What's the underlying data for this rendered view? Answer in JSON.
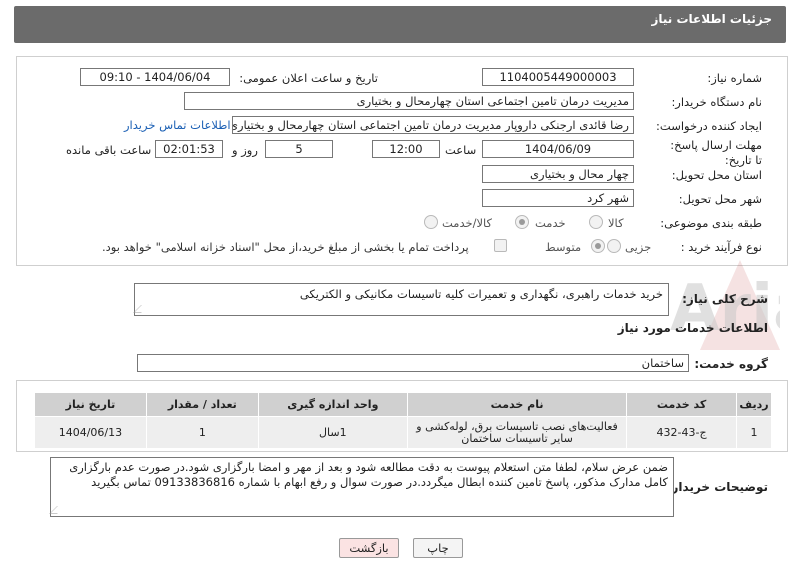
{
  "header": {
    "title": "جزئیات اطلاعات نیاز"
  },
  "need_number": {
    "label": "شماره نیاز:",
    "value": "1104005449000003"
  },
  "announce_datetime": {
    "label": "تاریخ و ساعت اعلان عمومی:",
    "value": "1404/06/04 - 09:10"
  },
  "buyer_org": {
    "label": "نام دستگاه خریدار:",
    "value": "مدیریت درمان تامین اجتماعی استان چهارمحال و بختیاری"
  },
  "requester": {
    "label": "ایجاد کننده درخواست:",
    "value": "رضا قائدی ارجنکی داروپار مدیریت درمان تامین اجتماعی استان چهارمحال و بختیاری",
    "contact_link": "اطلاعات تماس خریدار"
  },
  "deadline": {
    "label": "مهلت ارسال پاسخ: تا تاریخ:",
    "date": "1404/06/09",
    "time_label": "ساعت",
    "time": "12:00",
    "days": "5",
    "days_label": "روز و",
    "remaining": "02:01:53",
    "remaining_label": "ساعت باقی مانده"
  },
  "delivery_province": {
    "label": "استان محل تحویل:",
    "value": "چهار محال و بختیاری"
  },
  "delivery_city": {
    "label": "شهر محل تحویل:",
    "value": "شهر کرد"
  },
  "category": {
    "label": "طبقه بندی موضوعی:",
    "options": [
      "کالا",
      "خدمت",
      "کالا/خدمت"
    ],
    "selected": "خدمت"
  },
  "purchase_type": {
    "label": "نوع فرآیند خرید :",
    "options": [
      "جزیی",
      "متوسط"
    ],
    "selected": "متوسط",
    "treasury_note": "پرداخت تمام یا بخشی از مبلغ خرید،از محل \"اسناد خزانه اسلامی\" خواهد بود."
  },
  "description": {
    "label": "شرح کلی نیاز:",
    "value": "خرید خدمات راهبری، نگهداری و تعمیرات کلیه تاسیسات مکانیکی و الکتریکی"
  },
  "services_section": {
    "title": "اطلاعات خدمات مورد نیاز"
  },
  "service_group": {
    "label": "گروه خدمت:",
    "value": "ساختمان"
  },
  "services_table": {
    "headers": [
      "ردیف",
      "کد خدمت",
      "نام خدمت",
      "واحد اندازه گیری",
      "تعداد / مقدار",
      "تاریخ نیاز"
    ],
    "rows": [
      [
        "1",
        "ج-43-432",
        "فعالیت‌های نصب تاسیسات برق، لوله‌کشی و سایر تاسیسات ساختمان",
        "1سال",
        "1",
        "1404/06/13"
      ]
    ]
  },
  "buyer_notes": {
    "label": "توضیحات خریدار:",
    "value": "ضمن عرض سلام، لطفا متن استعلام پیوست به دقت مطالعه شود و بعد از مهر و امضا بارگزاری شود.در صورت عدم بارگزاری کامل مدارک مذکور، پاسخ تامین کننده ابطال میگردد.در صورت سوال و رفع ابهام با شماره 09133836816 تماس بگیرید"
  },
  "buttons": {
    "print": "چاپ",
    "back": "بازگشت"
  },
  "colors": {
    "header_bg": "#6b6b6b",
    "link": "#1a5fb4",
    "back_btn_bg": "#fbe3e3",
    "table_head": "#d0d0d0"
  },
  "watermark": {
    "text": "AriaTender.neT"
  }
}
